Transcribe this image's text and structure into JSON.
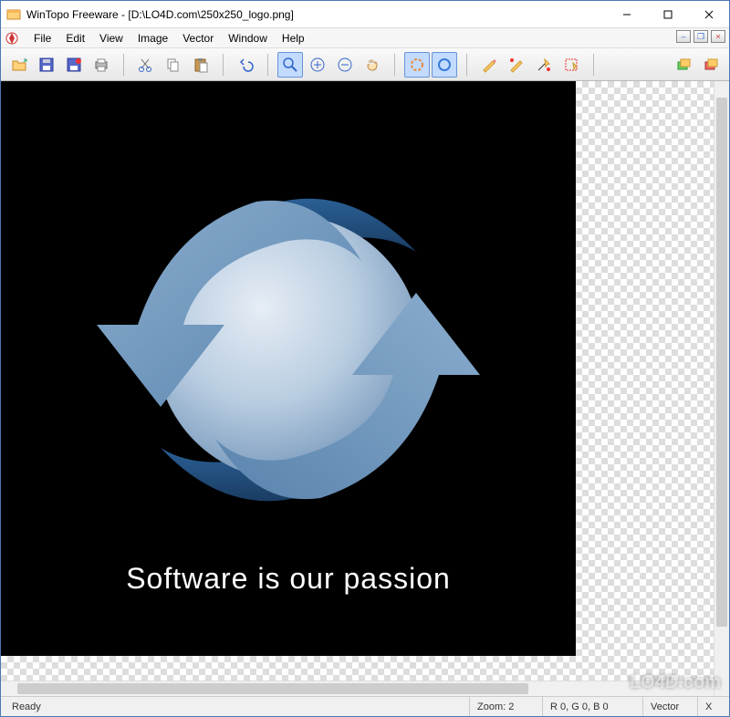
{
  "titlebar": {
    "title": "WinTopo Freeware - [D:\\LO4D.com\\250x250_logo.png]"
  },
  "menu": {
    "items": [
      "File",
      "Edit",
      "View",
      "Image",
      "Vector",
      "Window",
      "Help"
    ]
  },
  "toolbar_icons": {
    "open": "open-icon",
    "save": "save-icon",
    "save_as": "save-as-icon",
    "print": "print-icon",
    "cut": "cut-icon",
    "copy": "copy-icon",
    "paste": "paste-icon",
    "undo": "undo-icon",
    "zoom": "zoom-icon",
    "zoom_in": "zoom-in-icon",
    "zoom_out": "zoom-out-icon",
    "pan": "pan-icon",
    "trace_dotted": "trace-dotted-icon",
    "trace_solid": "trace-solid-icon",
    "draw": "draw-icon",
    "draw_ext": "draw-ext-icon",
    "vector_tool": "vector-tool-icon",
    "crop": "crop-icon",
    "layers_a": "layers-a-icon",
    "layers_b": "layers-b-icon"
  },
  "image": {
    "caption": "Software is our passion"
  },
  "status": {
    "ready": "Ready",
    "zoom": "Zoom: 2",
    "rgb": "R 0, G 0, B 0",
    "vector": "Vector",
    "coord": "X"
  },
  "watermark": "LO4D.com"
}
